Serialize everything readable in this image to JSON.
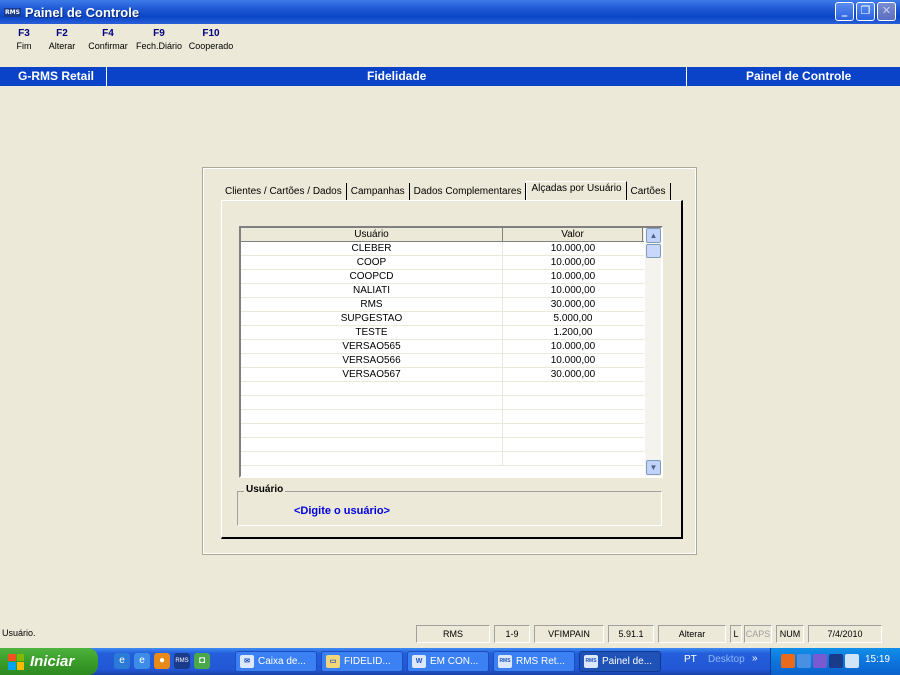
{
  "window": {
    "app_icon": "RMS",
    "title": "Painel de Controle"
  },
  "fkeys": [
    {
      "key": "F3",
      "label": "Fim"
    },
    {
      "key": "F2",
      "label": "Alterar"
    },
    {
      "key": "F4",
      "label": "Confirmar"
    },
    {
      "key": "F9",
      "label": "Fech.Diário"
    },
    {
      "key": "F10",
      "label": "Cooperado"
    }
  ],
  "header": {
    "left": "G-RMS Retail",
    "center": "Fidelidade",
    "right": "Painel de Controle"
  },
  "tabs": [
    {
      "label": "Clientes / Cartões / Dados",
      "active": false
    },
    {
      "label": "Campanhas",
      "active": false
    },
    {
      "label": "Dados Complementares",
      "active": false
    },
    {
      "label": "Alçadas por Usuário",
      "active": true
    },
    {
      "label": "Cartões",
      "active": false
    }
  ],
  "grid": {
    "columns": [
      "Usuário",
      "Valor"
    ],
    "rows": [
      [
        "CLEBER",
        "10.000,00"
      ],
      [
        "COOP",
        "10.000,00"
      ],
      [
        "COOPCD",
        "10.000,00"
      ],
      [
        "NALIATI",
        "10.000,00"
      ],
      [
        "RMS",
        "30.000,00"
      ],
      [
        "SUPGESTAO",
        "5.000,00"
      ],
      [
        "TESTE",
        "1.200,00"
      ],
      [
        "VERSAO565",
        "10.000,00"
      ],
      [
        "VERSAO566",
        "10.000,00"
      ],
      [
        "VERSAO567",
        "30.000,00"
      ],
      [
        "",
        ""
      ],
      [
        "",
        ""
      ],
      [
        "",
        ""
      ],
      [
        "",
        ""
      ],
      [
        "",
        ""
      ],
      [
        "",
        ""
      ]
    ]
  },
  "user_group": {
    "title": "Usuário",
    "hint": "<Digite o usuário>"
  },
  "statusbar": {
    "message": "Usuário.",
    "user": "RMS",
    "range": "1-9",
    "program": "VFIMPAIN",
    "version": "5.91.1",
    "mode": "Alterar",
    "l": "L",
    "caps": "CAPS",
    "num": "NUM",
    "date": "7/4/2010"
  },
  "taskbar": {
    "start_label": "Iniciar",
    "tasks": [
      "Caixa de...",
      "FIDELID...",
      "EM CON...",
      "RMS Ret...",
      "Painel de..."
    ],
    "language": "PT",
    "desktop_label": "Desktop",
    "clock": "15:19"
  },
  "colors": {
    "title_blue": "#0a43c8",
    "hint_blue": "#0000e0",
    "face": "#ece9d8"
  }
}
